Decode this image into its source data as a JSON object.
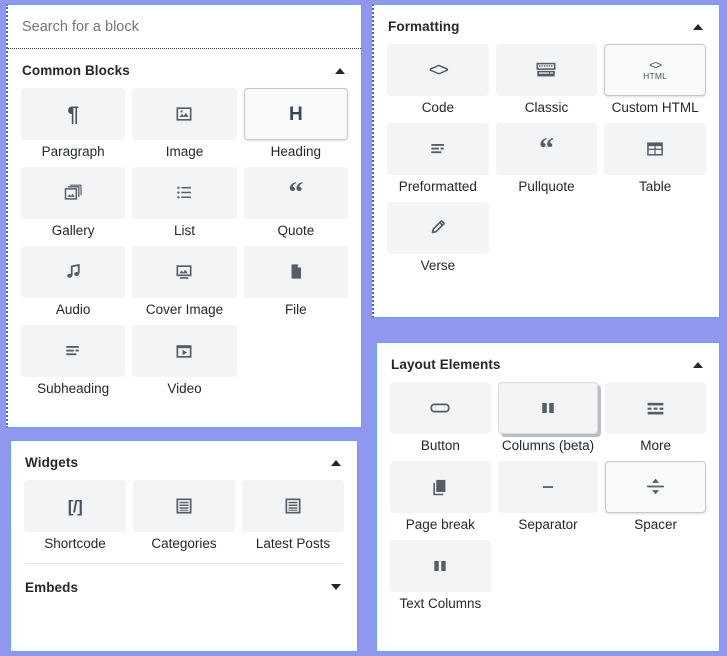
{
  "theme": {
    "background": "#8f97ee",
    "panel_background": "#ffffff",
    "panel_border": "#66a6e8",
    "tile_background": "#f3f4f5",
    "icon_color": "#555d66",
    "text_color": "#23282d",
    "placeholder_color": "#757575"
  },
  "search": {
    "placeholder": "Search for a block",
    "value": ""
  },
  "panels": {
    "common_blocks": {
      "title": "Common Blocks",
      "collapsed": false,
      "caret": "caret-up-icon",
      "items": [
        {
          "label": "Paragraph",
          "icon": "paragraph-icon",
          "state": "default"
        },
        {
          "label": "Image",
          "icon": "image-icon",
          "state": "default"
        },
        {
          "label": "Heading",
          "icon": "heading-icon",
          "state": "hovered"
        },
        {
          "label": "Gallery",
          "icon": "gallery-icon",
          "state": "default"
        },
        {
          "label": "List",
          "icon": "list-icon",
          "state": "default"
        },
        {
          "label": "Quote",
          "icon": "quote-icon",
          "state": "default"
        },
        {
          "label": "Audio",
          "icon": "audio-icon",
          "state": "default"
        },
        {
          "label": "Cover Image",
          "icon": "cover-image-icon",
          "state": "default"
        },
        {
          "label": "File",
          "icon": "file-icon",
          "state": "default"
        },
        {
          "label": "Subheading",
          "icon": "subheading-icon",
          "state": "default"
        },
        {
          "label": "Video",
          "icon": "video-icon",
          "state": "default"
        }
      ]
    },
    "widgets": {
      "title": "Widgets",
      "collapsed": false,
      "caret": "caret-up-icon",
      "items": [
        {
          "label": "Shortcode",
          "icon": "shortcode-icon",
          "state": "default"
        },
        {
          "label": "Categories",
          "icon": "categories-icon",
          "state": "default"
        },
        {
          "label": "Latest Posts",
          "icon": "latest-posts-icon",
          "state": "default"
        }
      ]
    },
    "embeds": {
      "title": "Embeds",
      "collapsed": true,
      "caret": "caret-down-icon"
    },
    "formatting": {
      "title": "Formatting",
      "collapsed": false,
      "caret": "caret-up-icon",
      "items": [
        {
          "label": "Code",
          "icon": "code-icon",
          "state": "default"
        },
        {
          "label": "Classic",
          "icon": "classic-icon",
          "state": "default"
        },
        {
          "label": "Custom HTML",
          "icon": "custom-html-icon",
          "state": "hovered"
        },
        {
          "label": "Preformatted",
          "icon": "preformatted-icon",
          "state": "default"
        },
        {
          "label": "Pullquote",
          "icon": "pullquote-icon",
          "state": "default"
        },
        {
          "label": "Table",
          "icon": "table-icon",
          "state": "default"
        },
        {
          "label": "Verse",
          "icon": "verse-icon",
          "state": "default"
        }
      ]
    },
    "layout_elements": {
      "title": "Layout Elements",
      "collapsed": false,
      "caret": "caret-up-icon",
      "items": [
        {
          "label": "Button",
          "icon": "button-icon",
          "state": "default"
        },
        {
          "label": "Columns (beta)",
          "icon": "columns-icon",
          "state": "lifted"
        },
        {
          "label": "More",
          "icon": "more-icon",
          "state": "default"
        },
        {
          "label": "Page break",
          "icon": "page-break-icon",
          "state": "default"
        },
        {
          "label": "Separator",
          "icon": "separator-icon",
          "state": "default"
        },
        {
          "label": "Spacer",
          "icon": "spacer-icon",
          "state": "hovered"
        },
        {
          "label": "Text Columns",
          "icon": "text-columns-icon",
          "state": "default"
        }
      ]
    }
  }
}
